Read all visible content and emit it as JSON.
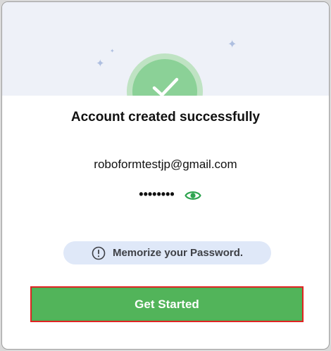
{
  "dialog": {
    "title": "Account created successfully",
    "email": "roboformtestjp@gmail.com",
    "password_mask": "••••••••",
    "memo_text": "Memorize your Password.",
    "get_started_label": "Get Started"
  },
  "icons": {
    "hero": "check-icon",
    "reveal_password": "eye-icon",
    "memo": "exclamation-circle-icon",
    "decor": "sparkle-icon"
  },
  "colors": {
    "accent_green": "#52b45a",
    "check_circle": "#8bd197",
    "check_ring": "#bfe3c3",
    "hero_background": "#eef1f8",
    "memo_background": "#dfe8f8",
    "highlight_border": "#e02323",
    "eye_icon": "#2ea44f"
  }
}
